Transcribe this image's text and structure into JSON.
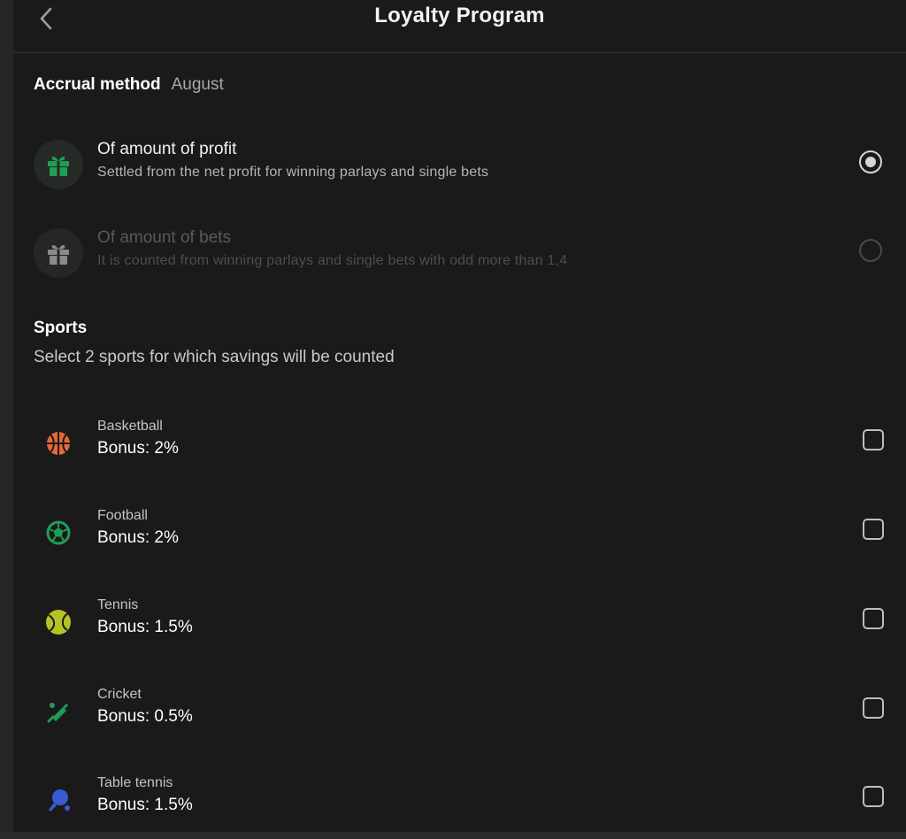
{
  "header": {
    "title": "Loyalty Program",
    "back_icon": "chevron-left-icon"
  },
  "accrual": {
    "title": "Accrual method",
    "period": "August",
    "options": [
      {
        "title": "Of amount of profit",
        "description": "Settled from the net profit for winning parlays and single bets",
        "icon": "gift-icon",
        "selected": true,
        "enabled": true,
        "icon_color": "#1f9d55"
      },
      {
        "title": "Of amount of bets",
        "description": "It is counted from winning parlays and single bets with odd more than 1,4",
        "icon": "gift-icon",
        "selected": false,
        "enabled": false,
        "icon_color": "#8a8a8a"
      }
    ]
  },
  "sports": {
    "title": "Sports",
    "subtitle": "Select 2 sports for which savings will be counted",
    "items": [
      {
        "name": "Basketball",
        "bonus": "Bonus: 2%",
        "icon": "basketball-icon",
        "checked": false,
        "icon_color": "#e8673a"
      },
      {
        "name": "Football",
        "bonus": "Bonus: 2%",
        "icon": "soccer-ball-icon",
        "checked": false,
        "icon_color": "#1f9d55"
      },
      {
        "name": "Tennis",
        "bonus": "Bonus: 1.5%",
        "icon": "tennis-ball-icon",
        "checked": false,
        "icon_color": "#b5c324"
      },
      {
        "name": "Cricket",
        "bonus": "Bonus: 0.5%",
        "icon": "cricket-bat-icon",
        "checked": false,
        "icon_color": "#1f9d55"
      },
      {
        "name": "Table tennis",
        "bonus": "Bonus: 1.5%",
        "icon": "table-tennis-icon",
        "checked": false,
        "icon_color": "#3b5bd6"
      }
    ]
  }
}
